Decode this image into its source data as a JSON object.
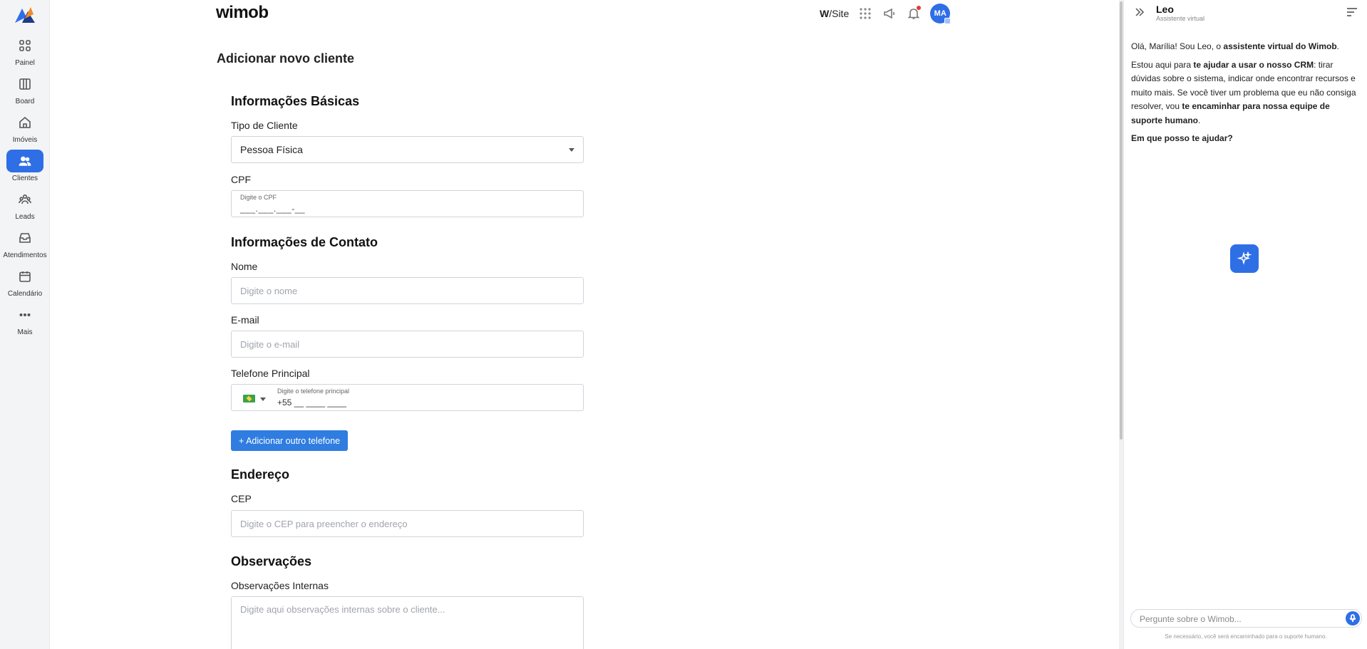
{
  "sidebar": {
    "items": [
      {
        "label": "Painel",
        "icon": "grid-icon"
      },
      {
        "label": "Board",
        "icon": "columns-icon"
      },
      {
        "label": "Imóveis",
        "icon": "home-icon"
      },
      {
        "label": "Clientes",
        "icon": "users-icon",
        "active": true
      },
      {
        "label": "Leads",
        "icon": "group-icon"
      },
      {
        "label": "Atendimentos",
        "icon": "inbox-icon"
      },
      {
        "label": "Calendário",
        "icon": "calendar-icon"
      },
      {
        "label": "Mais",
        "icon": "more-icon"
      }
    ]
  },
  "header": {
    "brand": "wimob",
    "wsite_prefix": "W",
    "wsite_suffix": "/Site",
    "avatar_initials": "MA"
  },
  "page": {
    "title": "Adicionar novo cliente"
  },
  "form": {
    "basic": {
      "title": "Informações Básicas",
      "client_type_label": "Tipo de Cliente",
      "client_type_value": "Pessoa Física",
      "cpf_label": "CPF",
      "cpf_mini_label": "Digite o CPF",
      "cpf_mask": "___.___.___-__"
    },
    "contact": {
      "title": "Informações de Contato",
      "name_label": "Nome",
      "name_placeholder": "Digite o nome",
      "email_label": "E-mail",
      "email_placeholder": "Digite o e-mail",
      "phone_label": "Telefone Principal",
      "phone_mini_label": "Digite o telefone principal",
      "phone_mask": "+55 __ ____ ____",
      "add_phone_button": "+ Adicionar outro telefone"
    },
    "address": {
      "title": "Endereço",
      "cep_label": "CEP",
      "cep_placeholder": "Digite o CEP para preencher o endereço"
    },
    "notes": {
      "title": "Observações",
      "internal_label": "Observações Internas",
      "internal_placeholder": "Digite aqui observações internas sobre o cliente..."
    }
  },
  "assistant": {
    "name": "Leo",
    "subtitle": "Assistente virtual",
    "msg1_a": "Olá, Marília! Sou Leo, o ",
    "msg1_b": "assistente virtual do Wimob",
    "msg1_c": ".",
    "msg2_a": "Estou aqui para ",
    "msg2_b": "te ajudar a usar o nosso CRM",
    "msg2_c": ": tirar dúvidas sobre o sistema, indicar onde encontrar recursos e muito mais. Se você tiver um problema que eu não consiga resolver, vou ",
    "msg2_d": "te encaminhar para nossa equipe de suporte humano",
    "msg2_e": ".",
    "msg3": "Em que posso te ajudar?",
    "input_placeholder": "Pergunte sobre o Wimob...",
    "footer": "Se necessário, você será encaminhado para o suporte humano."
  },
  "colors": {
    "primary": "#2f6fe6",
    "button": "#2f7de1",
    "notification": "#e53935"
  }
}
